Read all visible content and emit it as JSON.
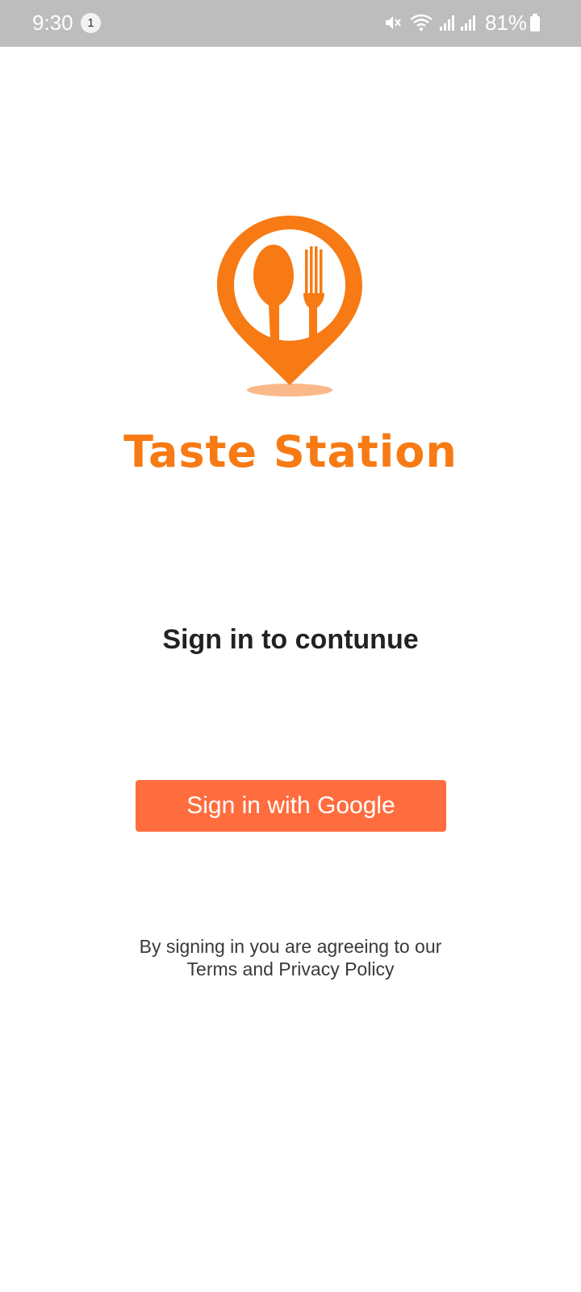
{
  "status_bar": {
    "time": "9:30",
    "notification_count": "1",
    "battery": "81%",
    "icons": [
      "mute-icon",
      "wifi-icon",
      "signal-icon",
      "signal-icon",
      "battery-icon"
    ]
  },
  "brand": {
    "logo_icon": "spoon-fork-location-pin-icon",
    "name": "Taste Station",
    "color": "#f77a14"
  },
  "login": {
    "heading": "Sign in to contunue",
    "google_button_label": "Sign in with Google",
    "button_color": "#ff6d3f",
    "terms_line1": "By signing in you are agreeing to our",
    "terms_line2": "Terms and Privacy Policy"
  }
}
